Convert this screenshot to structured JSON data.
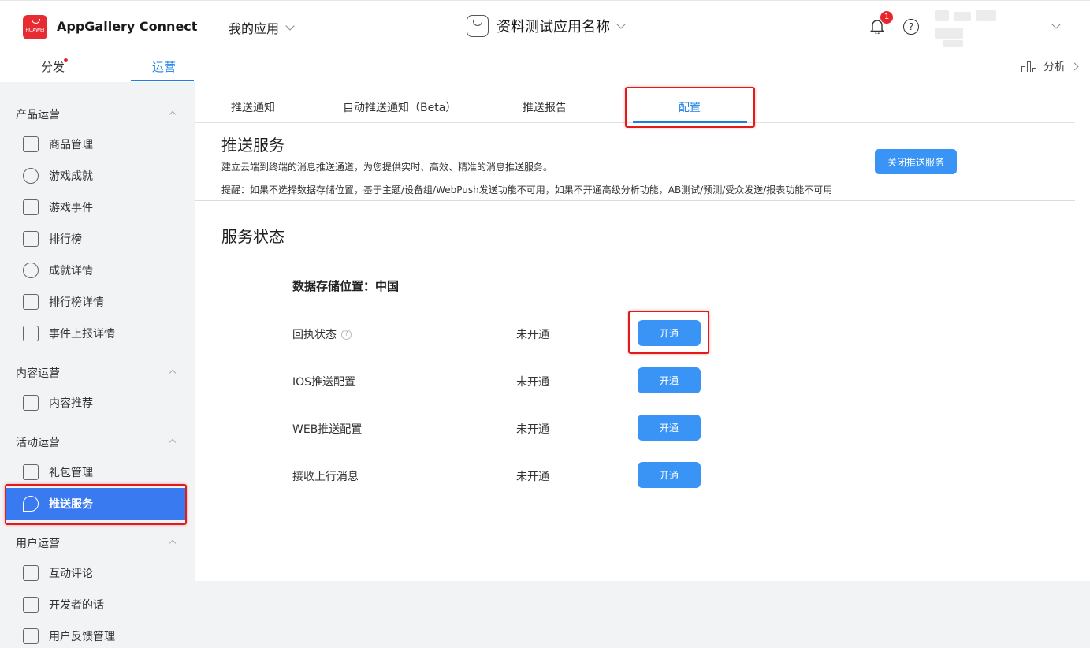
{
  "header": {
    "logo_text": "HUAWEI",
    "brand": "AppGallery Connect",
    "my_apps": "我的应用",
    "app_name": "资料测试应用名称",
    "notification_count": "1",
    "help": "?"
  },
  "subnav": {
    "tabs": [
      "分发",
      "运营"
    ],
    "analysis": "分析"
  },
  "sidebar": {
    "groups": [
      {
        "label": "产品运营",
        "items": [
          "商品管理",
          "游戏成就",
          "游戏事件",
          "排行榜",
          "成就详情",
          "排行榜详情",
          "事件上报详情"
        ]
      },
      {
        "label": "内容运营",
        "items": [
          "内容推荐"
        ]
      },
      {
        "label": "活动运营",
        "items": [
          "礼包管理",
          "推送服务"
        ]
      },
      {
        "label": "用户运营",
        "items": [
          "互动评论",
          "开发者的话",
          "用户反馈管理"
        ]
      }
    ]
  },
  "tabs": [
    "推送通知",
    "自动推送通知（Beta）",
    "推送报告",
    "配置"
  ],
  "push": {
    "title": "推送服务",
    "description": "建立云端到终端的消息推送通道，为您提供实时、高效、精准的消息推送服务。",
    "note": "提醒：如果不选择数据存储位置，基于主题/设备组/WebPush发送功能不可用，如果不开通高级分析功能，AB测试/预测/受众发送/报表功能不可用",
    "close_button": "关闭推送服务"
  },
  "status": {
    "title": "服务状态",
    "storage": "数据存储位置：中国",
    "rows": [
      {
        "label": "回执状态",
        "status": "未开通",
        "button": "开通"
      },
      {
        "label": "IOS推送配置",
        "status": "未开通",
        "button": "开通"
      },
      {
        "label": "WEB推送配置",
        "status": "未开通",
        "button": "开通"
      },
      {
        "label": "接收上行消息",
        "status": "未开通",
        "button": "开通"
      }
    ]
  },
  "colors": {
    "accent": "#3a94f5",
    "active_nav": "#3a7af0",
    "highlight": "#e21a1a"
  }
}
